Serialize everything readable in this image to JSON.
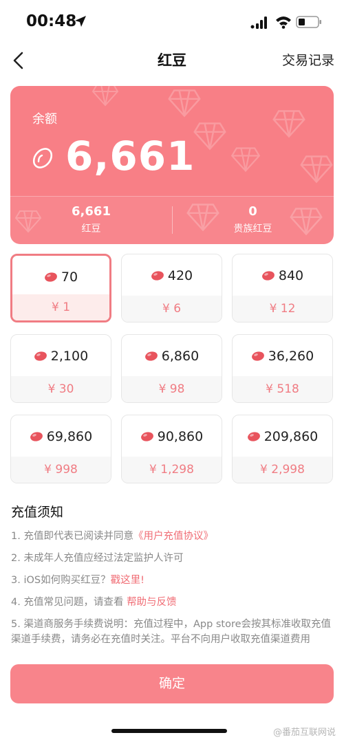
{
  "status_bar": {
    "time": "00:48",
    "location_icon": "location-arrow-icon",
    "signal_icon": "cellular-signal-icon",
    "wifi_icon": "wifi-icon",
    "battery_icon": "battery-icon"
  },
  "nav": {
    "back_icon": "chevron-left-icon",
    "title": "红豆",
    "action_label": "交易记录"
  },
  "balance": {
    "label": "余额",
    "value": "6,661",
    "icon": "bean-outline-icon",
    "stats": [
      {
        "value": "6,661",
        "label": "红豆"
      },
      {
        "value": "0",
        "label": "贵族红豆"
      }
    ]
  },
  "packages": {
    "items": [
      {
        "amount": "70",
        "price": "¥ 1",
        "selected": true
      },
      {
        "amount": "420",
        "price": "¥ 6",
        "selected": false
      },
      {
        "amount": "840",
        "price": "¥ 12",
        "selected": false
      },
      {
        "amount": "2,100",
        "price": "¥ 30",
        "selected": false
      },
      {
        "amount": "6,860",
        "price": "¥ 98",
        "selected": false
      },
      {
        "amount": "36,260",
        "price": "¥ 518",
        "selected": false
      },
      {
        "amount": "69,860",
        "price": "¥ 998",
        "selected": false
      },
      {
        "amount": "90,860",
        "price": "¥ 1,298",
        "selected": false
      },
      {
        "amount": "209,860",
        "price": "¥ 2,998",
        "selected": false
      }
    ]
  },
  "notes": {
    "title": "充值须知",
    "items": [
      {
        "text": "1. 充值即代表已阅读并同意",
        "link": "《用户充值协议》"
      },
      {
        "text": "2. 未成年人充值应经过法定监护人许可",
        "link": ""
      },
      {
        "text": "3. iOS如何购买红豆？",
        "link": "戳这里!"
      },
      {
        "text": "4. 充值常见问题，请查看 ",
        "link": "帮助与反馈"
      },
      {
        "text": "5. 渠道商服务手续费说明：充值过程中，App store会按其标准收取充值渠道手续费，请务必在充值时关注。平台不向用户收取充值渠道费用",
        "link": ""
      }
    ]
  },
  "confirm_label": "确定",
  "watermark": "@番茄互联网说",
  "colors": {
    "accent": "#f87f86",
    "link": "#f06c74",
    "price": "#f07c83",
    "bean": "#e8545d"
  }
}
